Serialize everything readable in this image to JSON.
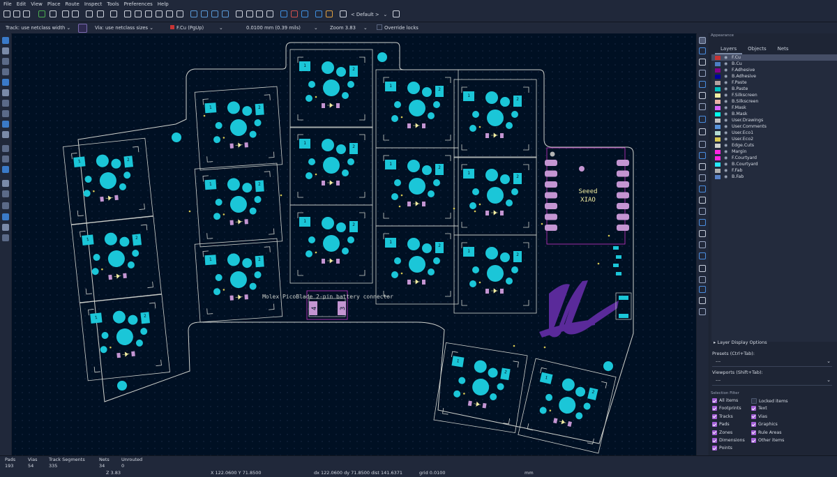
{
  "menu": [
    "File",
    "Edit",
    "View",
    "Place",
    "Route",
    "Inspect",
    "Tools",
    "Preferences",
    "Help"
  ],
  "toolbar": {
    "icons": [
      "new-board-icon",
      "open-icon",
      "save-icon",
      "board-setup-icon",
      "page-settings-icon",
      "print-icon",
      "plot-icon",
      "undo-icon",
      "redo-icon",
      "find-icon",
      "refresh-icon",
      "zoom-in-icon",
      "zoom-out-icon",
      "zoom-fit-icon",
      "zoom-objects-icon",
      "zoom-selection-icon",
      "rotate-ccw-icon",
      "rotate-cw-icon",
      "flip-icon",
      "mirror-icon",
      "group-icon",
      "ungroup-icon",
      "lock-icon",
      "unlock-icon",
      "netlist-icon",
      "footprint-editor-icon",
      "footprint-browser-icon",
      "update-pcb-icon",
      "drc-icon",
      "scripting-icon",
      "console-icon"
    ],
    "preset": "< Default >"
  },
  "options": {
    "track": "Track: use netclass width",
    "via": "Via: use netclass sizes",
    "layer": "F.Cu (PgUp)",
    "grid": "0.0100 mm (0.39 mils)",
    "zoom": "Zoom 3.83",
    "override_locks": "Override locks"
  },
  "appearance": {
    "title": "Appearance",
    "tabs": [
      "Layers",
      "Objects",
      "Nets"
    ],
    "layers": [
      {
        "name": "F.Cu",
        "color": "#c83434"
      },
      {
        "name": "B.Cu",
        "color": "#4d7fc4"
      },
      {
        "name": "F.Adhesive",
        "color": "#84008a"
      },
      {
        "name": "B.Adhesive",
        "color": "#0000a0"
      },
      {
        "name": "F.Paste",
        "color": "#b4a0a0"
      },
      {
        "name": "B.Paste",
        "color": "#00c2c2"
      },
      {
        "name": "F.Silkscreen",
        "color": "#f2eda1"
      },
      {
        "name": "B.Silkscreen",
        "color": "#e8b2a7"
      },
      {
        "name": "F.Mask",
        "color": "#d864ff"
      },
      {
        "name": "B.Mask",
        "color": "#02ffee"
      },
      {
        "name": "User.Drawings",
        "color": "#c2c2c2"
      },
      {
        "name": "User.Comments",
        "color": "#5994dc"
      },
      {
        "name": "User.Eco1",
        "color": "#b4dbd2"
      },
      {
        "name": "User.Eco2",
        "color": "#d8c852"
      },
      {
        "name": "Edge.Cuts",
        "color": "#d0d2cd"
      },
      {
        "name": "Margin",
        "color": "#ff26e2"
      },
      {
        "name": "F.Courtyard",
        "color": "#ff26e2"
      },
      {
        "name": "B.Courtyard",
        "color": "#26e9ff"
      },
      {
        "name": "F.Fab",
        "color": "#afafaf"
      },
      {
        "name": "B.Fab",
        "color": "#5882c8"
      }
    ],
    "layer_display_options": "Layer Display Options",
    "presets_label": "Presets (Ctrl+Tab):",
    "presets_value": "---",
    "viewports_label": "Viewports (Shift+Tab):",
    "viewports_value": "---",
    "selection_filter": "Selection Filter",
    "filters_left": [
      {
        "label": "All items",
        "checked": true
      },
      {
        "label": "Footprints",
        "checked": true
      },
      {
        "label": "Tracks",
        "checked": true
      },
      {
        "label": "Pads",
        "checked": true
      },
      {
        "label": "Zones",
        "checked": true
      },
      {
        "label": "Dimensions",
        "checked": true
      },
      {
        "label": "Points",
        "checked": true
      }
    ],
    "filters_right": [
      {
        "label": "Locked items",
        "checked": false
      },
      {
        "label": "Text",
        "checked": true
      },
      {
        "label": "Vias",
        "checked": true
      },
      {
        "label": "Graphics",
        "checked": true
      },
      {
        "label": "Rule Areas",
        "checked": true
      },
      {
        "label": "Other items",
        "checked": true
      }
    ]
  },
  "canvas": {
    "mcu_label_1": "Seeed",
    "mcu_label_2": "XIAO",
    "connector_label": "Molex PicoBlade 2-pin battery connector",
    "pin1": "1",
    "pin2": "2",
    "conn_pin1": "4",
    "conn_pin2": "3",
    "colors": {
      "edge": "#d0d2cd",
      "pad": "#1bc6d8",
      "smd": "#c495d2",
      "courtyard": "#c832c8",
      "logo": "#5a2a9a"
    }
  },
  "status": {
    "pads_label": "Pads",
    "pads": "193",
    "vias_label": "Vias",
    "vias": "54",
    "tracks_label": "Track Segments",
    "tracks": "335",
    "nets_label": "Nets",
    "nets": "34",
    "unrouted_label": "Unrouted",
    "unrouted": "0",
    "zoom": "Z 3.83",
    "xy": "X 122.0600  Y 71.8500",
    "dxy": "dx 122.0600  dy 71.8500  dist 141.6371",
    "grid": "grid 0.0100",
    "units": "mm"
  }
}
